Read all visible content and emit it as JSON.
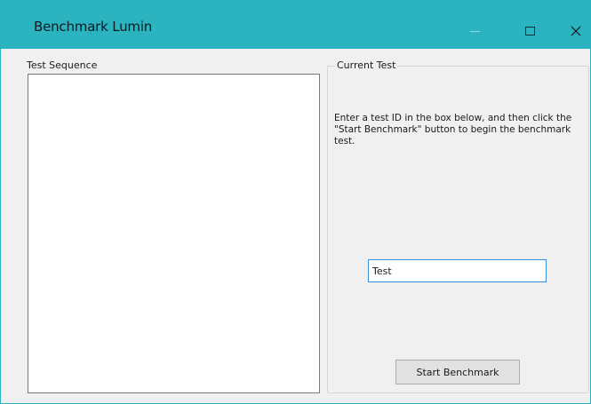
{
  "window": {
    "title": "Benchmark Lumin",
    "accent_color": "#2bb3c0"
  },
  "titlebar_buttons": {
    "minimize_icon": "minimize-icon",
    "maximize_icon": "maximize-icon",
    "close_icon": "close-icon"
  },
  "test_sequence": {
    "label": "Test Sequence",
    "items": []
  },
  "current_test": {
    "group_label": "Current Test",
    "instructions": "Enter a test ID in the box below, and then click the \"Start Benchmark\" button to begin the benchmark test.",
    "test_id_value": "Test",
    "start_button_label": "Start Benchmark"
  }
}
